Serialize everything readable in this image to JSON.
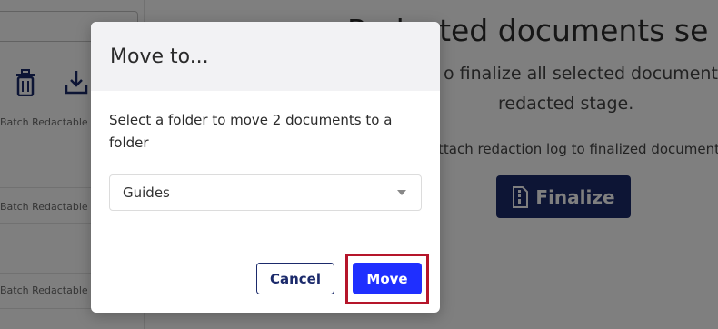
{
  "background": {
    "card_label": "Batch Redactable",
    "title": "Redacted documents se",
    "subtitle_line1": "o finalize all selected document an",
    "subtitle_line2": "redacted stage.",
    "checkbox_label": "ttach redaction log to finalized documents",
    "finalize_label": "Finalize"
  },
  "modal": {
    "title": "Move to...",
    "message": "Select a folder to move 2 documents to a folder",
    "folder_select": {
      "value": "Guides"
    },
    "cancel_label": "Cancel",
    "move_label": "Move"
  },
  "colors": {
    "primary": "#1f2fff",
    "navy": "#1b2a6b",
    "highlight": "#b5152a",
    "overlay": "rgba(0,0,0,0.5)"
  }
}
